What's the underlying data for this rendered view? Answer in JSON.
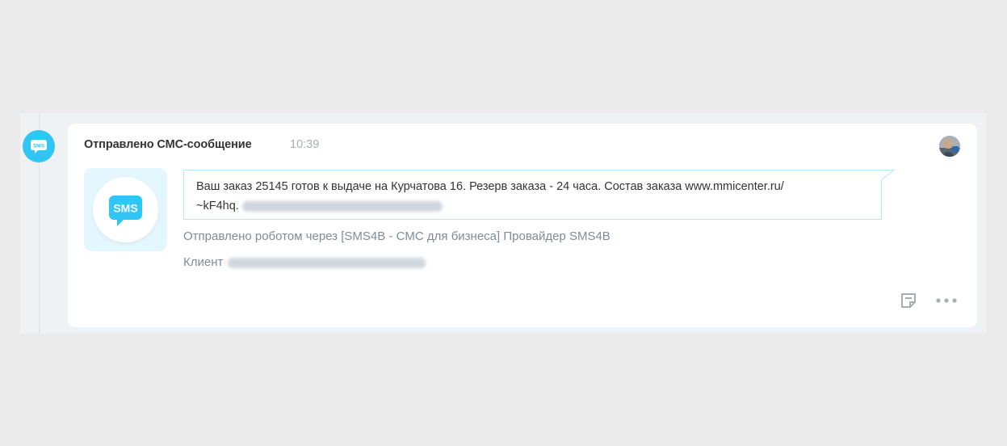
{
  "activity": {
    "title": "Отправлено СМС-сообщение",
    "time": "10:39",
    "timeline_icon_label": "SMS",
    "logo_label": "SMS",
    "message_line1": "Ваш заказ 25145 готов к выдаче на Курчатова 16. Резерв заказа - 24 часа. Состав заказа www.mmicenter.ru/",
    "message_line2": "~kF4hq.",
    "sent_via": "Отправлено роботом через [SMS4B - CMC для бизнеса] Провайдер SMS4B",
    "client_label": "Клиент"
  },
  "icons": {
    "timeline": "sms-bubble-icon",
    "note": "note-icon",
    "more": "more-dots-icon"
  },
  "colors": {
    "accent": "#2fc6f6",
    "page_bg": "#ebebeb",
    "card_bg": "#ffffff",
    "bubble_border": "#b8e6f8",
    "muted_text": "#828b95"
  }
}
